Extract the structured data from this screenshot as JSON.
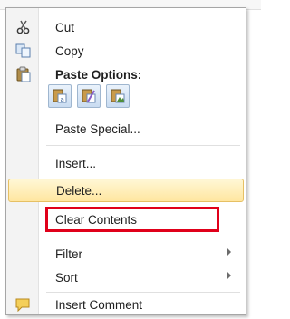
{
  "menu": {
    "items": {
      "cut": {
        "label": "Cut",
        "icon": "scissors-icon"
      },
      "copy": {
        "label": "Copy",
        "icon": "copy-icon"
      },
      "paste_options": {
        "label": "Paste Options:",
        "icon": "paste-icon"
      },
      "paste_special": {
        "label": "Paste Special..."
      },
      "insert": {
        "label": "Insert..."
      },
      "delete": {
        "label": "Delete..."
      },
      "clear_contents": {
        "label": "Clear Contents"
      },
      "filter": {
        "label": "Filter"
      },
      "sort": {
        "label": "Sort"
      },
      "insert_comment": {
        "label": "Insert Comment",
        "icon": "comment-icon"
      }
    },
    "paste_buttons": [
      "paste-values-icon",
      "paste-formatting-icon",
      "paste-picture-icon"
    ]
  },
  "colors": {
    "hover_gradient_top": "#fff7d5",
    "hover_gradient_bottom": "#ffe6a0",
    "highlight_border": "#e0001a"
  }
}
